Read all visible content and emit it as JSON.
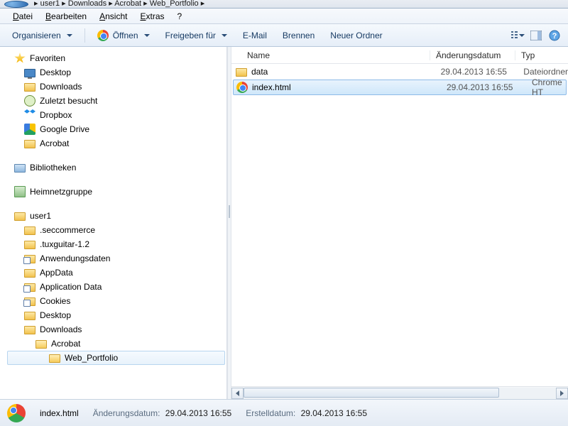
{
  "breadcrumb": [
    "user1",
    "Downloads",
    "Acrobat",
    "Web_Portfolio"
  ],
  "menu": {
    "file": "Datei",
    "edit": "Bearbeiten",
    "view": "Ansicht",
    "extras": "Extras",
    "help": "?"
  },
  "toolbar": {
    "organize": "Organisieren",
    "open": "Öffnen",
    "share": "Freigeben für",
    "email": "E-Mail",
    "burn": "Brennen",
    "newfolder": "Neuer Ordner"
  },
  "columns": {
    "name": "Name",
    "date": "Änderungsdatum",
    "type": "Typ"
  },
  "tree": {
    "favorites": "Favoriten",
    "desktop": "Desktop",
    "downloads": "Downloads",
    "recent": "Zuletzt besucht",
    "dropbox": "Dropbox",
    "gdrive": "Google Drive",
    "acrobat": "Acrobat",
    "libraries": "Bibliotheken",
    "homegroup": "Heimnetzgruppe",
    "user": "user1",
    "seccommerce": ".seccommerce",
    "tuxguitar": ".tuxguitar-1.2",
    "anwendungsdaten": "Anwendungsdaten",
    "appdata": "AppData",
    "applicationdata": "Application Data",
    "cookies": "Cookies",
    "desktop2": "Desktop",
    "downloads2": "Downloads",
    "acrobat2": "Acrobat",
    "webportfolio": "Web_Portfolio"
  },
  "files": [
    {
      "name": "data",
      "date": "29.04.2013 16:55",
      "type": "Dateiordner",
      "icon": "folder",
      "selected": false
    },
    {
      "name": "index.html",
      "date": "29.04.2013 16:55",
      "type": "Chrome HT",
      "icon": "chrome",
      "selected": true
    }
  ],
  "status": {
    "filename": "index.html",
    "mod_label": "Änderungsdatum:",
    "mod_value": "29.04.2013 16:55",
    "created_label": "Erstelldatum:",
    "created_value": "29.04.2013 16:55"
  }
}
